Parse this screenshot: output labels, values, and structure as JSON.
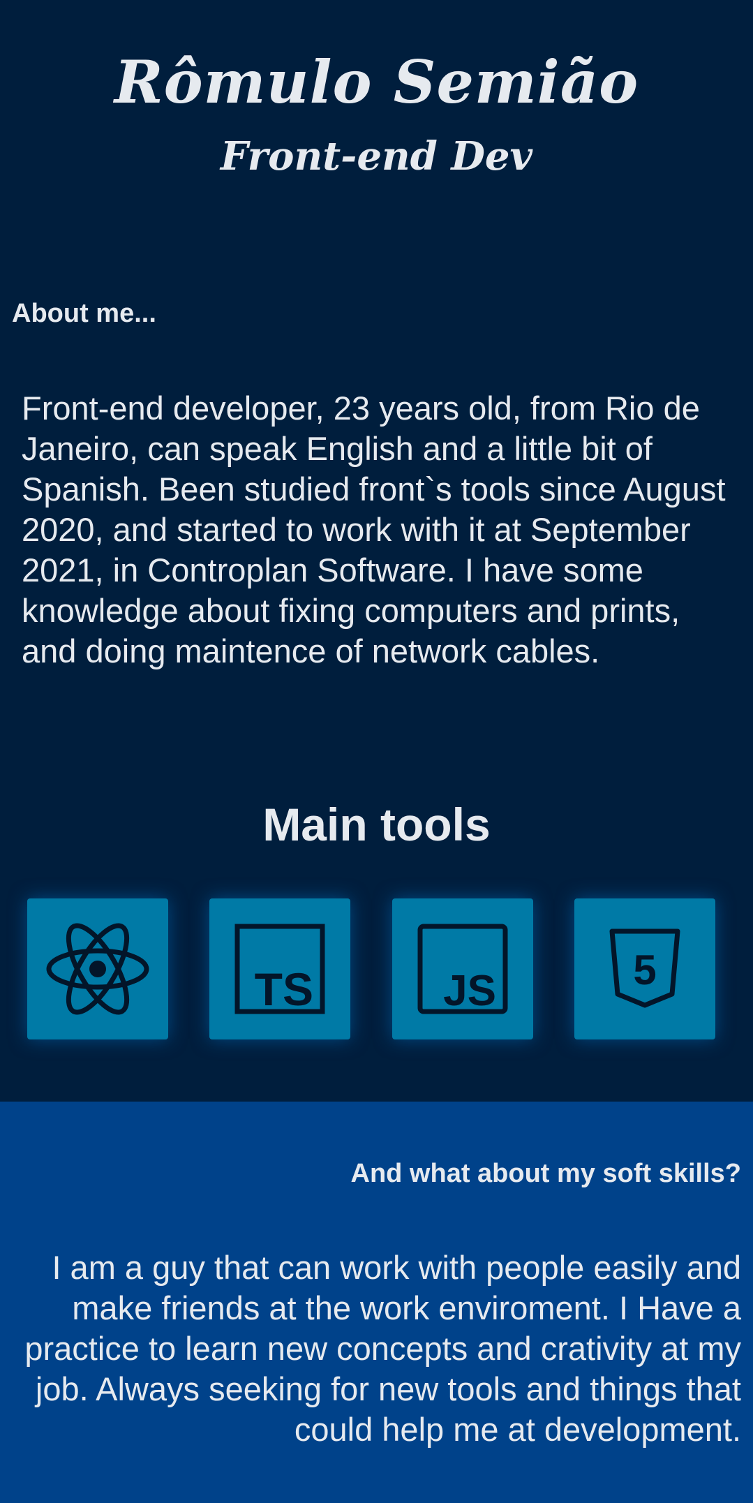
{
  "header": {
    "name": "Rômulo Semião",
    "role": "Front-end Dev"
  },
  "about": {
    "heading": "About me...",
    "text": "Front-end developer, 23 years old, from Rio de Janeiro, can speak English and a little bit of Spanish. Been studied front`s tools since August 2020, and started to work with it at September 2021, in Controplan Software. I have some knowledge about fixing computers and prints, and doing maintence of network cables."
  },
  "tools": {
    "heading": "Main tools",
    "items": [
      {
        "icon": "react-icon",
        "label": ""
      },
      {
        "icon": "typescript-icon",
        "label": "TS"
      },
      {
        "icon": "javascript-icon",
        "label": "JS"
      },
      {
        "icon": "html5-icon",
        "label": "5"
      }
    ]
  },
  "soft_skills": {
    "heading": "And what about my soft skills?",
    "text": "I am a guy that can work with people easily and make friends at the work enviroment. I Have a practice to learn new concepts and crativity at my job. Always seeking for new tools and things that could help me at development."
  },
  "colors": {
    "top_background": "#001e3d",
    "bottom_background": "#00428a",
    "tile": "#007aa6",
    "text": "#e6eaef",
    "icon": "#031529"
  }
}
